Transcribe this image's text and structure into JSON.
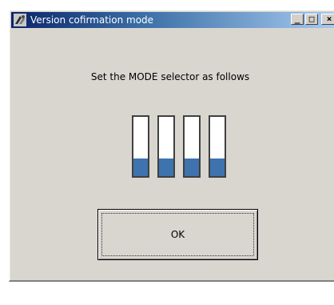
{
  "window": {
    "title": "Version cofirmation mode",
    "controls": {
      "minimize": "_",
      "maximize": "□",
      "close": "×"
    }
  },
  "main": {
    "instruction": "Set the MODE selector as follows",
    "mode_switches": [
      {
        "position": "down",
        "level": 0.3
      },
      {
        "position": "down",
        "level": 0.3
      },
      {
        "position": "down",
        "level": 0.3
      },
      {
        "position": "down",
        "level": 0.3
      }
    ],
    "ok_label": "OK"
  },
  "colors": {
    "title_gradient_start": "#0a246a",
    "title_gradient_end": "#a6caf0",
    "switch_fill": "#3e73ad",
    "window_bg": "#d9d6cf"
  },
  "icons": {
    "app": "app-icon"
  }
}
